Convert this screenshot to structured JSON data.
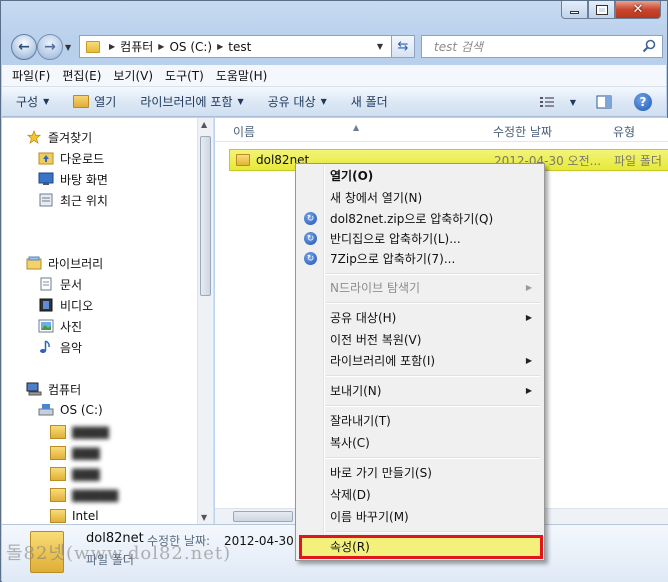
{
  "address": {
    "crumbs": [
      "컴퓨터",
      "OS (C:)",
      "test"
    ]
  },
  "search": {
    "placeholder": "test 검색"
  },
  "menubar": [
    "파일(F)",
    "편집(E)",
    "보기(V)",
    "도구(T)",
    "도움말(H)"
  ],
  "commands": {
    "organize": "구성",
    "open": "열기",
    "include_library": "라이브러리에 포함",
    "share": "공유 대상",
    "new_folder": "새 폴더"
  },
  "navpane": {
    "favorites": "즐겨찾기",
    "downloads": "다운로드",
    "desktop": "바탕 화면",
    "recent": "최근 위치",
    "libraries": "라이브러리",
    "documents": "문서",
    "videos": "비디오",
    "pictures": "사진",
    "music": "음악",
    "computer": "컴퓨터",
    "os_drive": "OS (C:)",
    "intel": "Intel"
  },
  "columns": {
    "name": "이름",
    "modified": "수정한 날짜",
    "type": "유형"
  },
  "file": {
    "name": "dol82net",
    "date": "2012-04-30 오전...",
    "type": "파일 폴더"
  },
  "details": {
    "name": "dol82net",
    "modified_label": "수정한 날짜:",
    "modified_value": "2012-04-30 오",
    "type": "파일 폴더"
  },
  "watermark": "돌82넷(www.dol82.net)",
  "context_menu": {
    "open": "열기(O)",
    "open_new_window": "새 창에서 열기(N)",
    "zip_compress": "dol82net.zip으로 압축하기(Q)",
    "bandizip": "반디집으로 압축하기(L)...",
    "sevenzip": "7Zip으로 압축하기(7)...",
    "ndrive": "N드라이브 탐색기",
    "share": "공유 대상(H)",
    "restore": "이전 버전 복원(V)",
    "library": "라이브러리에 포함(I)",
    "send_to": "보내기(N)",
    "cut": "잘라내기(T)",
    "copy": "복사(C)",
    "shortcut": "바로 가기 만들기(S)",
    "delete": "삭제(D)",
    "rename": "이름 바꾸기(M)",
    "properties": "속성(R)"
  },
  "colors": {
    "highlight_border": "#e0151d",
    "selection": "#e6ea36"
  }
}
